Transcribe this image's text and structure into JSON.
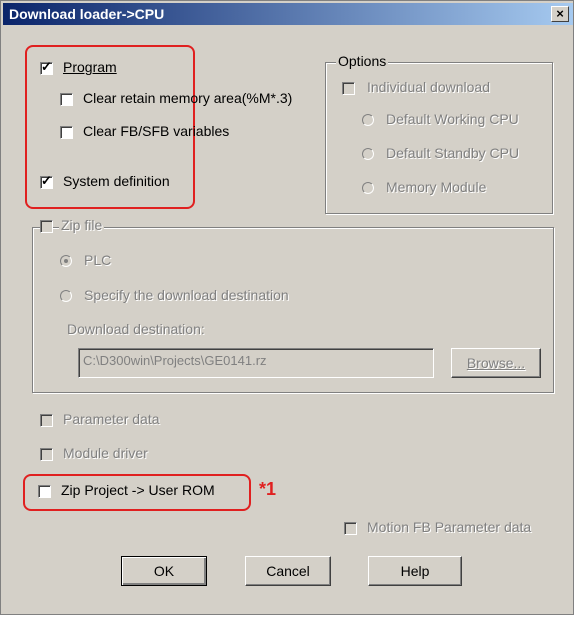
{
  "window": {
    "title": "Download loader->CPU",
    "close_label": "×"
  },
  "main": {
    "program": {
      "label": "Program",
      "checked": true
    },
    "clear_retain": {
      "label": "Clear retain memory area(%M*.3)",
      "checked": false
    },
    "clear_fb": {
      "label": "Clear FB/SFB variables",
      "checked": false
    },
    "system_definition": {
      "label": "System definition",
      "checked": true
    }
  },
  "options": {
    "legend": "Options",
    "individual_download": "Individual download",
    "default_working": "Default Working CPU",
    "default_standby": "Default Standby CPU",
    "memory_module": "Memory Module"
  },
  "zip": {
    "legend": "Zip file",
    "plc": "PLC",
    "specify": "Specify the download destination",
    "destination_label": "Download destination:",
    "destination_value": "C:\\D300win\\Projects\\GE0141.rz",
    "browse": "Browse..."
  },
  "lower": {
    "parameter_data": "Parameter data",
    "module_driver": "Module driver",
    "zip_project": "Zip Project -> User ROM",
    "note": "*1",
    "motion_fb": "Motion FB Parameter data"
  },
  "buttons": {
    "ok": "OK",
    "cancel": "Cancel",
    "help": "Help"
  },
  "colors": {
    "highlight": "#e02020",
    "titlebar": "#0a246a",
    "face": "#d4d0c8"
  }
}
